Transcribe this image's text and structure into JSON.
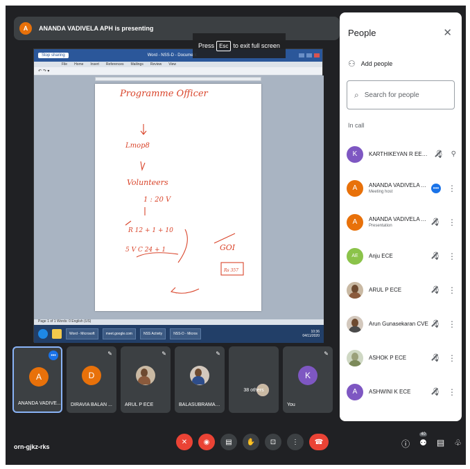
{
  "banner": {
    "avatar_letter": "A",
    "text": "ANANDA VADIVELA APH is presenting"
  },
  "fullscreen_tip": {
    "prefix": "Press",
    "key": "Esc",
    "suffix": "to exit full screen"
  },
  "shared_screen": {
    "window_title": "Word - NSS-D - Document",
    "share_button": "Stop sharing",
    "menu": [
      "File",
      "Home",
      "Insert",
      "References",
      "Mailings",
      "Review",
      "View"
    ],
    "status": "Page 1 of 1   Words: 0   English (US)",
    "taskbar_apps": [
      "Word - Microsoft",
      "meet.google.com",
      "NSS Activity",
      "NSS-D - Micros"
    ],
    "clock_time": "10:36",
    "clock_date": "04/11/2020",
    "handwriting": {
      "line1": "Programme Officer",
      "line2": "Lmop8",
      "line3": "Volunteers",
      "line4": "1 : 20 V",
      "line5": "R   12 + 1 + 10",
      "line6": "5 V C   24 + 1",
      "line7": "GOI",
      "line8": "Rs 357"
    }
  },
  "people_panel": {
    "title": "People",
    "close_icon": "close-icon",
    "add_people_label": "Add people",
    "search_placeholder": "Search for people",
    "section_label": "In call",
    "people": [
      {
        "name": "KARTHIKEYAN R EEE (You)",
        "role": "",
        "avatar": "K",
        "color": "#7e57c2"
      },
      {
        "name": "ANANDA VADIVELA APH",
        "role": "Meeting host",
        "avatar": "A",
        "color": "#e8710a"
      },
      {
        "name": "ANANDA VADIVELA APH",
        "role": "Presentation",
        "avatar": "A",
        "color": "#e8710a"
      },
      {
        "name": "Anju ECE",
        "role": "",
        "avatar": "AE",
        "color": "#8bc34a"
      },
      {
        "name": "ARUL P ECE",
        "role": "",
        "avatar": "",
        "color": ""
      },
      {
        "name": "Arun Gunasekaran CVE",
        "role": "",
        "avatar": "",
        "color": ""
      },
      {
        "name": "ASHOK P ECE",
        "role": "",
        "avatar": "",
        "color": ""
      },
      {
        "name": "ASHWINI K ECE",
        "role": "",
        "avatar": "A",
        "color": "#7e57c2"
      }
    ]
  },
  "tiles": [
    {
      "name": "ANANDA VADIVE...",
      "avatar": "A",
      "color": "#e8710a"
    },
    {
      "name": "DIRAVIA BALAN ...",
      "avatar": "D",
      "color": "#e8710a"
    },
    {
      "name": "ARUL P ECE",
      "avatar": "",
      "color": ""
    },
    {
      "name": "BALASUBRAMAN...",
      "avatar": "",
      "color": ""
    },
    {
      "name": "38 others",
      "avatar": "K",
      "color": "#7e57c2"
    },
    {
      "name": "You",
      "avatar": "K",
      "color": "#7e57c2"
    }
  ],
  "bottom_bar": {
    "meeting_code": "orn-gjkz-rks",
    "participant_count": "40"
  }
}
